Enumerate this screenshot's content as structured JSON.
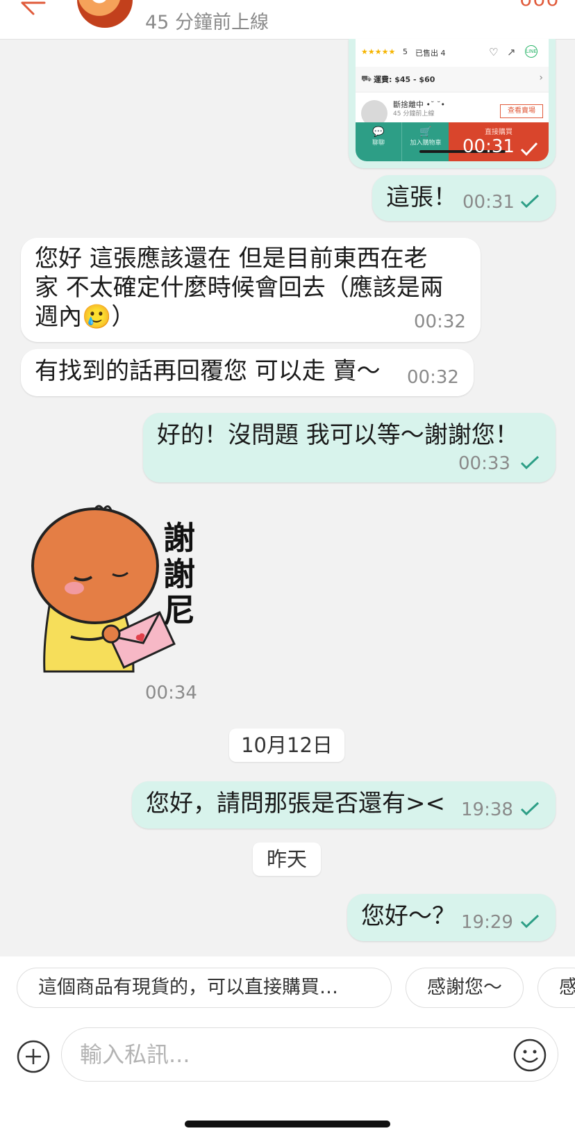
{
  "header": {
    "status": "45 分鐘前上線"
  },
  "product_card": {
    "stars": "★★★★★",
    "rating": "5",
    "sold": "已售出 4",
    "shipping": "運費: $45 - $60",
    "seller_name": "斷捨離中 •˘ ˘•",
    "seller_online": "45 分鐘前上線",
    "shop_button": "查看賣場",
    "chat_label": "聊聊",
    "cart_label": "加入購物車",
    "buy_label": "直接購買",
    "time": "00:31"
  },
  "messages": [
    {
      "direction": "out",
      "text": "這張！",
      "time": "00:31"
    },
    {
      "direction": "in",
      "lines": [
        "您好 這張應該還在 但是目前東西在老",
        "家 不太確定什麼時候會回去（應該是兩",
        "週內🥲）"
      ],
      "time": "00:32"
    },
    {
      "direction": "in",
      "text": "有找到的話再回覆您 可以走 賣～",
      "time": "00:32"
    },
    {
      "direction": "out",
      "text": "好的！沒問題 我可以等～謝謝您！",
      "time": "00:33"
    },
    {
      "direction": "in",
      "sticker_caption": "謝謝尼",
      "time": "00:34"
    },
    {
      "direction": "out",
      "text": "您好，請問那張是否還有><",
      "time": "19:38"
    },
    {
      "direction": "out",
      "text": "您好～？",
      "time": "19:29"
    }
  ],
  "date_separators": [
    "10月12日",
    "昨天"
  ],
  "quick_replies": [
    "這個商品有現貨的，可以直接購買…",
    "感謝您～",
    "感"
  ],
  "input": {
    "placeholder": "輸入私訊..."
  },
  "colors": {
    "outgoing_bubble": "#d8f3ec",
    "incoming_bubble": "#ffffff",
    "tick": "#2d9e86",
    "accent": "#e05a3a"
  }
}
